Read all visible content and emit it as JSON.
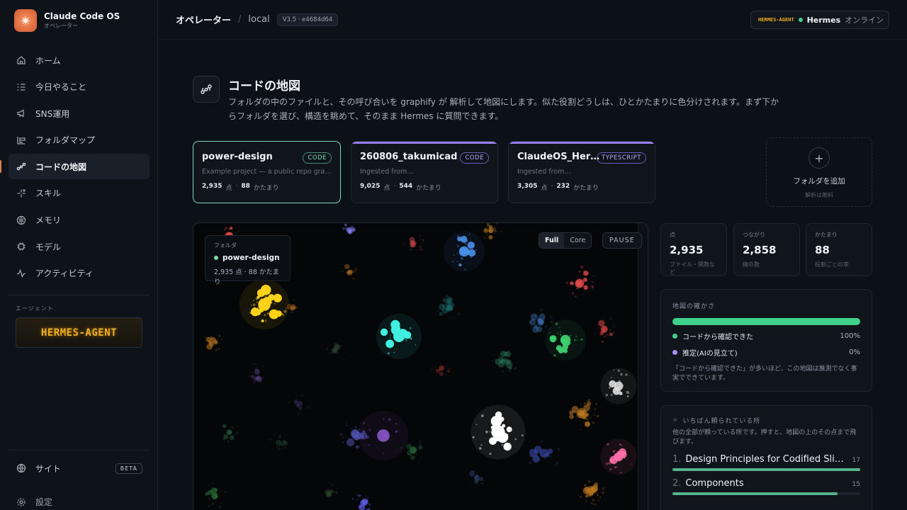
{
  "app": {
    "title": "Claude Code OS",
    "subtitle": "オペレーター"
  },
  "sidebar": {
    "items": [
      {
        "label": "ホーム",
        "icon": "home-icon"
      },
      {
        "label": "今日やること",
        "icon": "checklist-icon"
      },
      {
        "label": "SNS運用",
        "icon": "megaphone-icon"
      },
      {
        "label": "フォルダマップ",
        "icon": "folder-map-icon"
      },
      {
        "label": "コードの地図",
        "icon": "graph-icon"
      },
      {
        "label": "スキル",
        "icon": "sparkle-icon"
      },
      {
        "label": "メモリ",
        "icon": "brain-icon"
      },
      {
        "label": "モデル",
        "icon": "chip-icon"
      },
      {
        "label": "アクティビティ",
        "icon": "activity-icon"
      }
    ],
    "agent_section_label": "エージェント",
    "agent_logo": "HERMES-AGENT",
    "site_label": "サイト",
    "beta_label": "BETA",
    "settings_label": "設定"
  },
  "topbar": {
    "breadcrumb_main": "オペレーター",
    "breadcrumb_sep": "/",
    "breadcrumb_sub": "local",
    "version": "V3.5 · e4684d64",
    "agent_logo": "HERMES-AGENT",
    "agent_name": "Hermes",
    "agent_status": "オンライン"
  },
  "header": {
    "title": "コードの地図",
    "description": "フォルダの中のファイルと、その呼び合いを graphify が 解析して地図にします。似た役割どうしは、ひとかたまりに色分けされます。まず下からフォルダを選び、構造を眺めて、そのまま Hermes に質問できます。"
  },
  "folders": [
    {
      "name": "power-design",
      "tag": "CODE",
      "desc": "Example project — a public repo graph…",
      "points": "2,935",
      "points_label": "点",
      "clusters": "88",
      "clusters_label": "かたまり"
    },
    {
      "name": "260806_takumicad",
      "tag": "CODE",
      "desc": "Ingested from…",
      "points": "9,025",
      "points_label": "点",
      "clusters": "544",
      "clusters_label": "かたまり"
    },
    {
      "name": "ClaudeOS_Her…",
      "tag": "TYPESCRIPT",
      "desc": "Ingested from…",
      "points": "3,305",
      "points_label": "点",
      "clusters": "232",
      "clusters_label": "かたまり"
    }
  ],
  "add_folder": {
    "plus": "+",
    "label": "フォルダを追加",
    "sub": "解析は無料"
  },
  "graph": {
    "tooltip_label": "フォルダ",
    "tooltip_name": "power-design",
    "tooltip_stats": "2,935 点 · 88 かたまり",
    "view_full": "Full",
    "view_core": "Core",
    "pause": "PAUSE"
  },
  "stats": [
    {
      "label": "点",
      "value": "2,935",
      "sub": "ファイル・関数など"
    },
    {
      "label": "つながり",
      "value": "2,858",
      "sub": "線の数"
    },
    {
      "label": "かたまり",
      "value": "88",
      "sub": "役割ごとの束"
    }
  ],
  "confidence": {
    "title": "地図の確かさ",
    "bar_fraction": 1.0,
    "rows": [
      {
        "label": "コードから確認できた",
        "pct": "100%",
        "color": "#3fd08a"
      },
      {
        "label": "推定(AIの見立て)",
        "pct": "0%",
        "color": "#a98cf5"
      }
    ],
    "note": "「コードから確認できた」が多いほど、この地図は推測でなく事実でできています。"
  },
  "most_referenced": {
    "title": "いちばん頼られている所",
    "desc": "他の全部が頼っている所です。押すと、地図の上のその点まで飛びます。",
    "items": [
      {
        "num": "1.",
        "name": "Design Principles for Codified Slide …",
        "count": "17",
        "fraction": 1.0
      },
      {
        "num": "2.",
        "name": "Components",
        "count": "15",
        "fraction": 0.88
      }
    ]
  },
  "colors": {
    "accent_green": "#3fd08a",
    "accent_purple": "#9d7ef0",
    "selected_border": "#7ed8b4",
    "hermes_gold": "#f0b020"
  }
}
